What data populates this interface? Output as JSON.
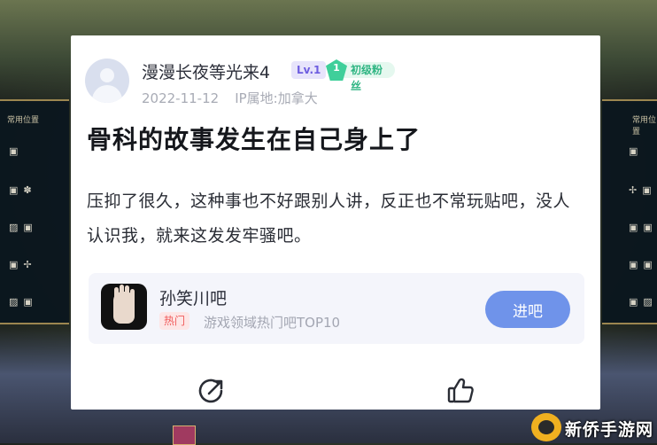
{
  "background": {
    "side_panel_title": "常用位置"
  },
  "post": {
    "author": {
      "name": "漫漫长夜等光来4",
      "level": "Lv.1",
      "fan_level": "1",
      "fan_badge": "初级粉丝"
    },
    "date": "2022-11-12",
    "ip_location": "IP属地:加拿大",
    "title": "骨科的故事发生在自己身上了",
    "body": "压抑了很久，这种事也不好跟别人讲，反正也不常玩贴吧，没人认识我，就来这发发牢骚吧。"
  },
  "forum": {
    "name": "孙笑川吧",
    "tag": "热门",
    "description": "游戏领域热门吧TOP10",
    "enter_label": "进吧"
  },
  "actions": {
    "repost_icon": "share-edit-icon",
    "like_icon": "thumbs-up-icon"
  },
  "watermark": {
    "text": "新侨手游网"
  },
  "colors": {
    "accent": "#6f93ea",
    "level_badge": "#6d5de0",
    "fan_badge": "#2fb583",
    "hot_tag": "#f05a5a"
  }
}
